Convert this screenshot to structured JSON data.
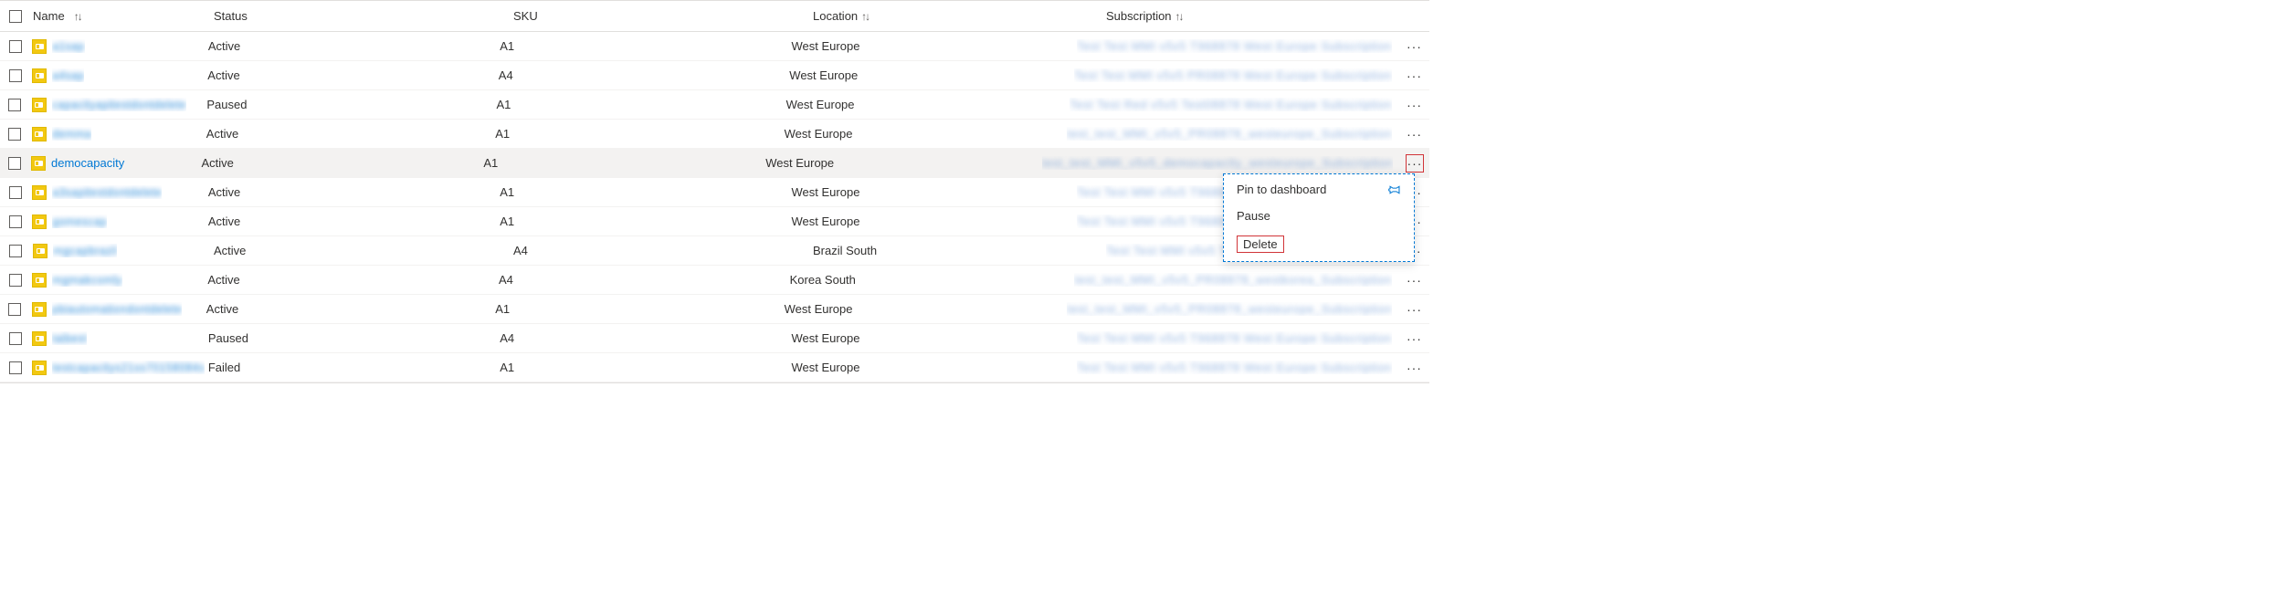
{
  "columns": {
    "name": "Name",
    "status": "Status",
    "sku": "SKU",
    "location": "Location",
    "subscription": "Subscription"
  },
  "rows": [
    {
      "name": "a1sap",
      "status": "Active",
      "sku": "A1",
      "location": "West Europe",
      "subscription": "Test Test MMI v5v5 T968878 West Europe Subscription",
      "blurred": true,
      "hovered": false
    },
    {
      "name": "a4sap",
      "status": "Active",
      "sku": "A4",
      "location": "West Europe",
      "subscription": "Test Test MMI v5v5 PR08878 West Europe Subscription",
      "blurred": true,
      "hovered": false
    },
    {
      "name": "capacityapitestdontdelete",
      "status": "Paused",
      "sku": "A1",
      "location": "West Europe",
      "subscription": "Test Test Red v5v5 Test08878 West Europe Subscription",
      "blurred": true,
      "hovered": false
    },
    {
      "name": "demma",
      "status": "Active",
      "sku": "A1",
      "location": "West Europe",
      "subscription": "test_test_MMI_v5v5_PR08878_westeurope_Subscription",
      "blurred": true,
      "hovered": false
    },
    {
      "name": "democapacity",
      "status": "Active",
      "sku": "A1",
      "location": "West Europe",
      "subscription": "test_test_MMI_v5v5_democapacity_westeurope_Subscription",
      "blurred": false,
      "hovered": true
    },
    {
      "name": "a3sapitestdontdelete",
      "status": "Active",
      "sku": "A1",
      "location": "West Europe",
      "subscription": "Test Test MMI v5v5 T968878 West Europe Subscription",
      "blurred": true,
      "hovered": false
    },
    {
      "name": "gomescap",
      "status": "Active",
      "sku": "A1",
      "location": "West Europe",
      "subscription": "Test Test MMI v5v5 T968878 West Europe Subscription",
      "blurred": true,
      "hovered": false
    },
    {
      "name": "mgcapbrazil",
      "status": "Active",
      "sku": "A4",
      "location": "Brazil South",
      "subscription": "Test Test MMI v5v5 T968878 Brazil Subscription",
      "blurred": true,
      "hovered": false
    },
    {
      "name": "mgmakcomly",
      "status": "Active",
      "sku": "A4",
      "location": "Korea South",
      "subscription": "test_test_MMI_v5v5_PR08878_westkorea_Subscription",
      "blurred": true,
      "hovered": false
    },
    {
      "name": "pbiautomationdontdelete",
      "status": "Active",
      "sku": "A1",
      "location": "West Europe",
      "subscription": "test_test_MMI_v5v5_PR08878_westeurope_Subscription",
      "blurred": true,
      "hovered": false
    },
    {
      "name": "taibest",
      "status": "Paused",
      "sku": "A4",
      "location": "West Europe",
      "subscription": "Test Test MMI v5v5 T968878 West Europe Subscription",
      "blurred": true,
      "hovered": false
    },
    {
      "name": "testcapacitys21ss70158084s",
      "status": "Failed",
      "sku": "A1",
      "location": "West Europe",
      "subscription": "Test Test MMI v5v5 T968878 West Europe Subscription",
      "blurred": true,
      "hovered": false
    }
  ],
  "context_menu": {
    "pin": "Pin to dashboard",
    "pause": "Pause",
    "delete": "Delete"
  }
}
